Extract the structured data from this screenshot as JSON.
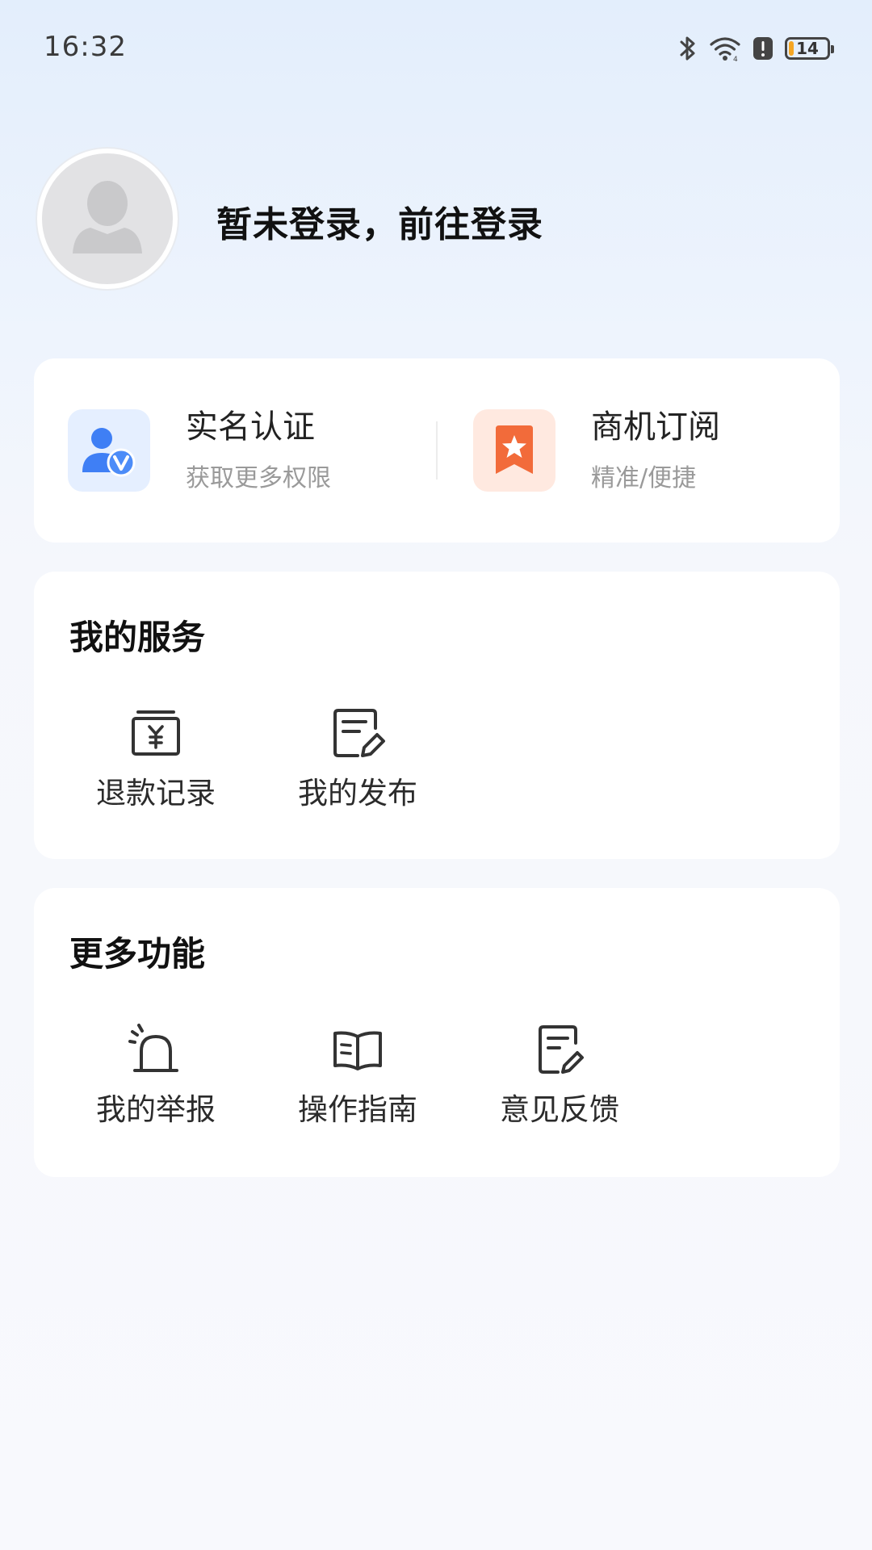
{
  "status_bar": {
    "time": "16:32",
    "battery_level": "14",
    "battery_percent": 14,
    "icons": [
      "bluetooth-icon",
      "wifi-icon",
      "alert-icon",
      "battery-icon"
    ]
  },
  "profile": {
    "avatar_icon": "default-avatar-icon",
    "login_prompt": "暂未登录，前往登录"
  },
  "quick_actions": [
    {
      "title": "实名认证",
      "subtitle": "获取更多权限",
      "icon": "verified-user-icon",
      "color": "#3f7ff5"
    },
    {
      "title": "商机订阅",
      "subtitle": "精准/便捷",
      "icon": "star-bookmark-icon",
      "color": "#f26b3a"
    }
  ],
  "services": {
    "title": "我的服务",
    "items": [
      {
        "label": "退款记录",
        "icon": "refund-record-icon"
      },
      {
        "label": "我的发布",
        "icon": "edit-document-icon"
      }
    ]
  },
  "more": {
    "title": "更多功能",
    "items": [
      {
        "label": "我的举报",
        "icon": "alarm-icon"
      },
      {
        "label": "操作指南",
        "icon": "open-book-icon"
      },
      {
        "label": "意见反馈",
        "icon": "feedback-icon"
      }
    ]
  }
}
